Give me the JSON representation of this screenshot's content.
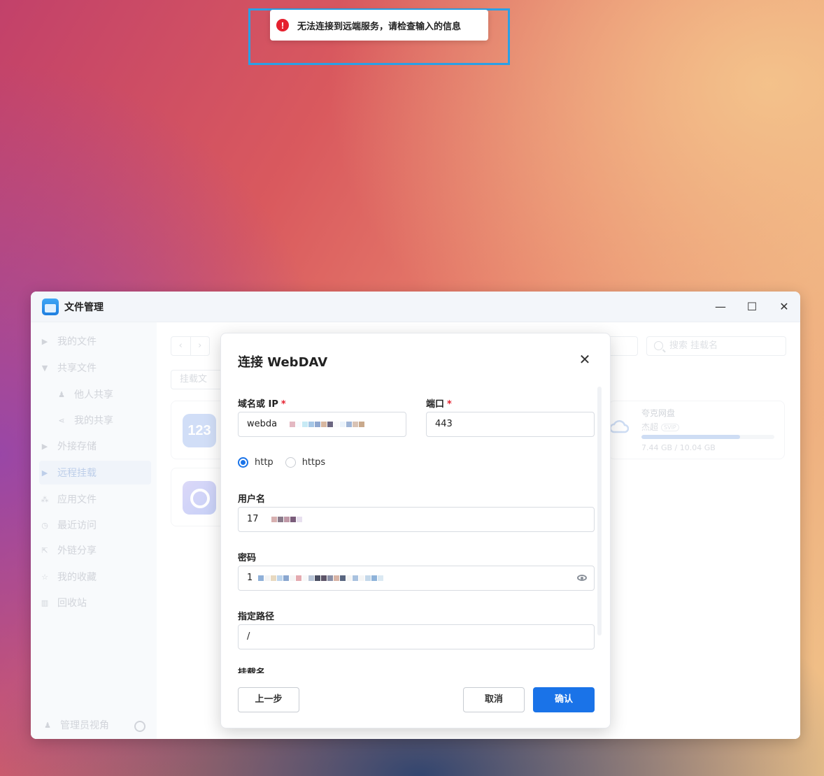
{
  "toast": {
    "icon": "error-icon",
    "message": "无法连接到远端服务，请检查输入的信息"
  },
  "window": {
    "title": "文件管理",
    "controls": {
      "minimize": "—",
      "maximize": "☐",
      "close": "✕"
    }
  },
  "sidebar": {
    "items": [
      {
        "label": "我的文件",
        "glyph": "▶"
      },
      {
        "label": "共享文件",
        "glyph": "▼"
      },
      {
        "label": "他人共享",
        "glyph": "♟"
      },
      {
        "label": "我的共享",
        "glyph": "⋖"
      },
      {
        "label": "外接存储",
        "glyph": "▶"
      },
      {
        "label": "远程挂载",
        "glyph": "▶"
      },
      {
        "label": "应用文件",
        "glyph": "⁂"
      },
      {
        "label": "最近访问",
        "glyph": "◷"
      },
      {
        "label": "外链分享",
        "glyph": "⇱"
      },
      {
        "label": "我的收藏",
        "glyph": "☆"
      },
      {
        "label": "回收站",
        "glyph": "▥"
      }
    ],
    "footer": "管理员视角"
  },
  "main": {
    "nav_back": "‹",
    "nav_forward": "›",
    "mount_button": "挂载文",
    "search_placeholder": "搜索 挂载名",
    "card_123_label": "123",
    "quark": {
      "name": "夸克网盘",
      "user": "杰超",
      "badge": "SVIP",
      "usage": "7.44 GB / 10.04 GB",
      "usage_fraction": 0.741
    }
  },
  "dialog": {
    "title": "连接 WebDAV",
    "close": "✕",
    "host_label": "域名或 IP",
    "host_value": "webda",
    "port_label": "端口",
    "port_value": "443",
    "required_mark": "*",
    "protocol_options": [
      "http",
      "https"
    ],
    "protocol_selected": "http",
    "username_label": "用户名",
    "username_value": "17",
    "password_label": "密码",
    "password_value": "1",
    "path_label": "指定路径",
    "path_value": "/",
    "mount_name_label": "挂载名",
    "buttons": {
      "prev": "上一步",
      "cancel": "取消",
      "confirm": "确认"
    }
  },
  "colors": {
    "accent": "#1a73e8",
    "error": "#e5202e",
    "highlight_box": "#2aa0e6"
  }
}
